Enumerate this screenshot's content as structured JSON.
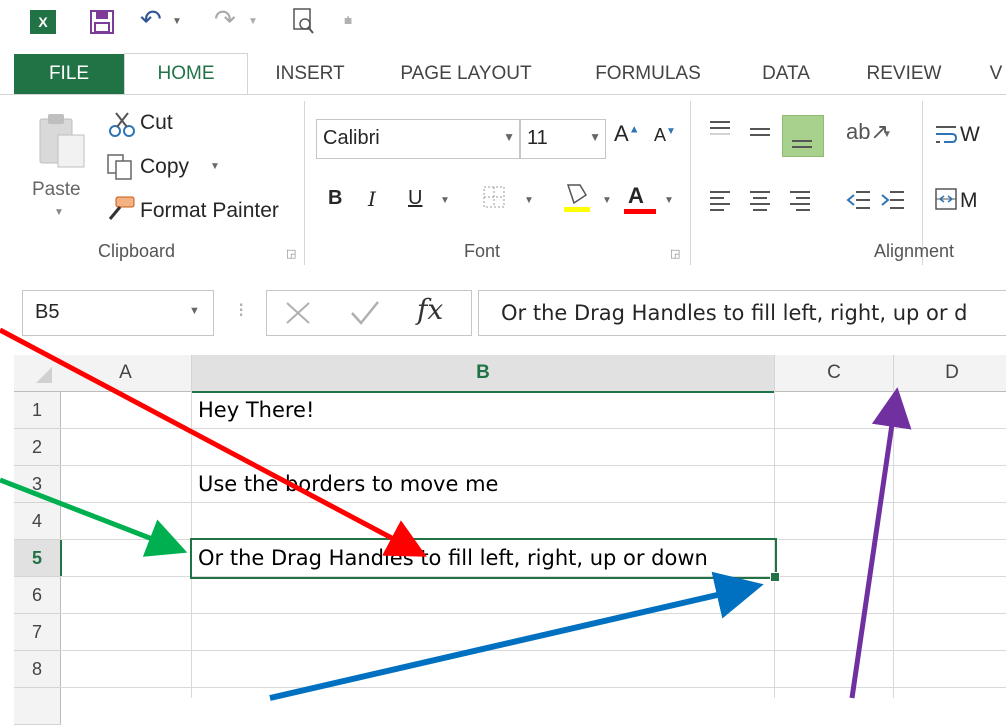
{
  "qat": {
    "icons": [
      "excel-logo-icon",
      "save-icon",
      "undo-icon",
      "redo-icon",
      "print-preview-icon",
      "customize-qat-icon"
    ]
  },
  "tabs": [
    {
      "label": "FILE"
    },
    {
      "label": "HOME"
    },
    {
      "label": "INSERT"
    },
    {
      "label": "PAGE LAYOUT"
    },
    {
      "label": "FORMULAS"
    },
    {
      "label": "DATA"
    },
    {
      "label": "REVIEW"
    },
    {
      "label": "V"
    }
  ],
  "clipboard": {
    "paste_label": "Paste",
    "cut_label": "Cut",
    "copy_label": "Copy",
    "format_painter_label": "Format Painter",
    "group_label": "Clipboard"
  },
  "font": {
    "font_name": "Calibri",
    "font_size": "11",
    "bold_label": "B",
    "italic_label": "I",
    "underline_label": "U",
    "group_label": "Font",
    "highlight_color": "#FFFF00",
    "font_color": "#FF0000"
  },
  "alignment": {
    "wrap_label": "W",
    "merge_label": "M",
    "group_label": "Alignment"
  },
  "formula_bar": {
    "name_box": "B5",
    "fx_label": "fx",
    "formula": "Or the Drag Handles to fill left, right, up or d"
  },
  "grid": {
    "columns": [
      "A",
      "B",
      "C",
      "D"
    ],
    "rows": [
      "1",
      "2",
      "3",
      "4",
      "5",
      "6",
      "7",
      "8"
    ],
    "cells": {
      "B1": "Hey There!",
      "B3": "Use the borders to move me",
      "B5": "Or the Drag Handles to fill left, right, up or down"
    }
  },
  "colors": {
    "accent": "#217346",
    "arrow_red": "#FF0000",
    "arrow_green": "#00B050",
    "arrow_blue": "#0070C0",
    "arrow_purple": "#7030A0"
  }
}
